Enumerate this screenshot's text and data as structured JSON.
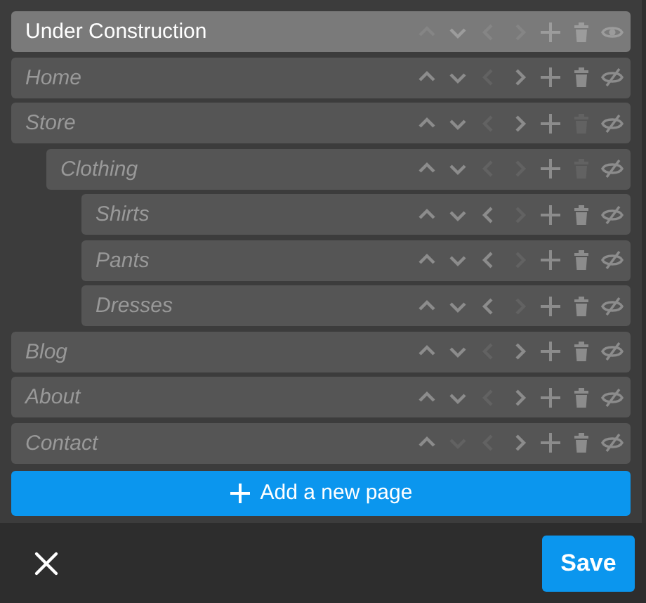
{
  "pages": [
    {
      "title": "Under Construction",
      "selected": true,
      "visible": true,
      "actions": [
        {
          "kind": "up",
          "enabled": false
        },
        {
          "kind": "down",
          "enabled": true
        },
        {
          "kind": "left",
          "enabled": false
        },
        {
          "kind": "right",
          "enabled": false
        },
        {
          "kind": "add",
          "enabled": true
        },
        {
          "kind": "delete",
          "enabled": true
        }
      ]
    },
    {
      "title": "Home",
      "selected": false,
      "visible": false,
      "actions": [
        {
          "kind": "up",
          "enabled": true
        },
        {
          "kind": "down",
          "enabled": true
        },
        {
          "kind": "left",
          "enabled": false
        },
        {
          "kind": "right",
          "enabled": true
        },
        {
          "kind": "add",
          "enabled": true
        },
        {
          "kind": "delete",
          "enabled": true
        }
      ]
    },
    {
      "title": "Store",
      "selected": false,
      "visible": false,
      "actions": [
        {
          "kind": "up",
          "enabled": true
        },
        {
          "kind": "down",
          "enabled": true
        },
        {
          "kind": "left",
          "enabled": false
        },
        {
          "kind": "right",
          "enabled": true
        },
        {
          "kind": "add",
          "enabled": true
        },
        {
          "kind": "delete",
          "enabled": false
        }
      ],
      "children": [
        {
          "title": "Clothing",
          "selected": false,
          "visible": false,
          "actions": [
            {
              "kind": "up",
              "enabled": true
            },
            {
              "kind": "down",
              "enabled": true
            },
            {
              "kind": "left",
              "enabled": false
            },
            {
              "kind": "right",
              "enabled": false
            },
            {
              "kind": "add",
              "enabled": true
            },
            {
              "kind": "delete",
              "enabled": false
            }
          ],
          "children": [
            {
              "title": "Shirts",
              "selected": false,
              "visible": false,
              "actions": [
                {
                  "kind": "up",
                  "enabled": true
                },
                {
                  "kind": "down",
                  "enabled": true
                },
                {
                  "kind": "left",
                  "enabled": true
                },
                {
                  "kind": "right",
                  "enabled": false
                },
                {
                  "kind": "add",
                  "enabled": true
                },
                {
                  "kind": "delete",
                  "enabled": true
                }
              ]
            },
            {
              "title": "Pants",
              "selected": false,
              "visible": false,
              "actions": [
                {
                  "kind": "up",
                  "enabled": true
                },
                {
                  "kind": "down",
                  "enabled": true
                },
                {
                  "kind": "left",
                  "enabled": true
                },
                {
                  "kind": "right",
                  "enabled": false
                },
                {
                  "kind": "add",
                  "enabled": true
                },
                {
                  "kind": "delete",
                  "enabled": true
                }
              ]
            },
            {
              "title": "Dresses",
              "selected": false,
              "visible": false,
              "actions": [
                {
                  "kind": "up",
                  "enabled": true
                },
                {
                  "kind": "down",
                  "enabled": true
                },
                {
                  "kind": "left",
                  "enabled": true
                },
                {
                  "kind": "right",
                  "enabled": false
                },
                {
                  "kind": "add",
                  "enabled": true
                },
                {
                  "kind": "delete",
                  "enabled": true
                }
              ]
            }
          ]
        }
      ]
    },
    {
      "title": "Blog",
      "selected": false,
      "visible": false,
      "actions": [
        {
          "kind": "up",
          "enabled": true
        },
        {
          "kind": "down",
          "enabled": true
        },
        {
          "kind": "left",
          "enabled": false
        },
        {
          "kind": "right",
          "enabled": true
        },
        {
          "kind": "add",
          "enabled": true
        },
        {
          "kind": "delete",
          "enabled": true
        }
      ]
    },
    {
      "title": "About",
      "selected": false,
      "visible": false,
      "actions": [
        {
          "kind": "up",
          "enabled": true
        },
        {
          "kind": "down",
          "enabled": true
        },
        {
          "kind": "left",
          "enabled": false
        },
        {
          "kind": "right",
          "enabled": true
        },
        {
          "kind": "add",
          "enabled": true
        },
        {
          "kind": "delete",
          "enabled": true
        }
      ]
    },
    {
      "title": "Contact",
      "selected": false,
      "visible": false,
      "actions": [
        {
          "kind": "up",
          "enabled": true
        },
        {
          "kind": "down",
          "enabled": false
        },
        {
          "kind": "left",
          "enabled": false
        },
        {
          "kind": "right",
          "enabled": true
        },
        {
          "kind": "add",
          "enabled": true
        },
        {
          "kind": "delete",
          "enabled": true
        }
      ]
    }
  ],
  "add_button": {
    "label": "Add a new page"
  },
  "footer": {
    "save_label": "Save"
  }
}
